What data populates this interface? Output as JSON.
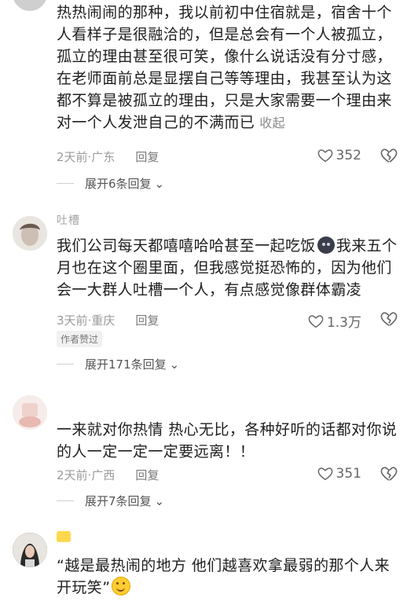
{
  "comments": [
    {
      "text": "热热闹闹的那种，我以前初中住宿就是，宿舍十个人看样子是很融洽的，但是总会有一个人被孤立，孤立的理由甚至很可笑，像什么说话没有分寸感，在老师面前总是显摆自己等等理由，我甚至认为这都不算是被孤立的理由，只是大家需要一个理由来对一个人发泄自己的不满而已",
      "collapse_label": "收起",
      "time": "2天前",
      "location": "广东",
      "reply_label": "回复",
      "likes": "352",
      "expand_label": "展开6条回复"
    },
    {
      "username": "吐槽",
      "text_before": "我们公司每天都嘻嘻哈哈甚至一起吃饭",
      "text_after": "我来五个月也在这个圈里面，但我感觉挺恐怖的，因为他们会一大群人吐槽一个人，有点感觉像群体霸凌",
      "time": "3天前",
      "location": "重庆",
      "reply_label": "回复",
      "likes": "1.3万",
      "author_badge": "作者赞过",
      "expand_label": "展开171条回复"
    },
    {
      "text": "一来就对你热情 热心无比，各种好听的话都对你说的人一定一定一定要远离！！",
      "time": "2天前",
      "location": "广西",
      "reply_label": "回复",
      "likes": "351",
      "expand_label": "展开7条回复"
    },
    {
      "text": "“越是最热闹的地方 他们越喜欢拿最弱的那个人来开玩笑”"
    }
  ],
  "separator": "·",
  "colors": {
    "text": "#1f1f1f",
    "meta": "#9a9a9a",
    "icon": "#666666"
  }
}
